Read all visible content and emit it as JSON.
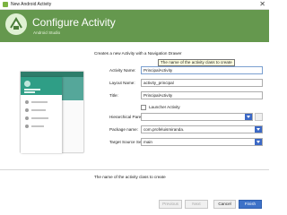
{
  "window": {
    "title": "New Android Activity",
    "close_glyph": "✕"
  },
  "header": {
    "title": "Configure Activity",
    "subtitle": "Android Studio",
    "logo_icon": "android-studio-logo"
  },
  "description": "Creates a new Activity with a Navigation Drawer",
  "tooltip": "The name of the activity class to create",
  "form": {
    "activity_name": {
      "label": "Activity Name:",
      "value": "PrincipalActivity"
    },
    "layout_name": {
      "label": "Layout Name:",
      "value": "activity_principal"
    },
    "title": {
      "label": "Title:",
      "value": "PrincipalActivity"
    },
    "launcher": {
      "label": "Launcher Activity",
      "checked": false
    },
    "hierarchical_parent": {
      "label": "Hierarchical Parent:",
      "value": ""
    },
    "package_name": {
      "label": "Package name:",
      "value": "com.profeluismiranda."
    },
    "target_source_set": {
      "label": "Target Source Set:",
      "value": "main"
    }
  },
  "info_text": "The name of the activity class to create",
  "buttons": {
    "previous": "Previous",
    "next": "Next",
    "cancel": "Cancel",
    "finish": "Finish"
  },
  "colors": {
    "header_green": "#65984e",
    "accent_blue": "#3d72c8",
    "drawer_teal": "#2f9e86"
  }
}
